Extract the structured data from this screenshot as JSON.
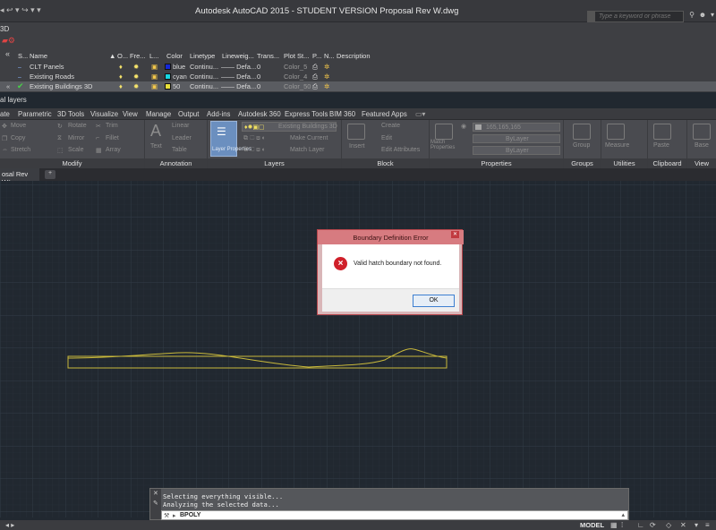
{
  "titlebar": {
    "title": "Autodesk AutoCAD 2015 - STUDENT VERSION    Proposal Rev W.dwg",
    "search_placeholder": "Type a keyword or phrase",
    "qat": "◂ ↩ ▾ ↪ ▾ ▾"
  },
  "layer_panel": {
    "top_label": "3D",
    "columns": {
      "status": "S...",
      "name": "Name",
      "on": "O...",
      "freeze": "Fre...",
      "lock": "L...",
      "color": "Color",
      "linetype": "Linetype",
      "lineweight": "Lineweig...",
      "transparency": "Trans...",
      "plotstyle": "Plot St...",
      "plot": "P...",
      "newvp": "N...",
      "description": "Description"
    },
    "rows": [
      {
        "name": "CLT Panels",
        "color": "blue",
        "color_hex": "#1428d8",
        "linetype": "Continu...",
        "lineweight": "Defa...",
        "transparency": "0",
        "plotstyle": "Color_5"
      },
      {
        "name": "Existing Roads",
        "color": "cyan",
        "color_hex": "#16d6e0",
        "linetype": "Continu...",
        "lineweight": "Defa...",
        "transparency": "0",
        "plotstyle": "Color_4"
      },
      {
        "name": "Existing Buildings 3D",
        "color": "50",
        "color_hex": "#e8e03a",
        "linetype": "Continu...",
        "lineweight": "Defa...",
        "transparency": "0",
        "plotstyle": "Color_50"
      }
    ],
    "footer": "al layers"
  },
  "ribbon_tabs": [
    "ate",
    "Parametric",
    "3D Tools",
    "Visualize",
    "View",
    "Manage",
    "Output",
    "Add-ins",
    "Autodesk 360",
    "Express Tools",
    "BIM 360",
    "Featured Apps"
  ],
  "ribbon": {
    "modify": {
      "label": "Modify",
      "items": [
        "Move",
        "Rotate",
        "Trim",
        "Copy",
        "Mirror",
        "Fillet",
        "Stretch",
        "Scale",
        "Array"
      ]
    },
    "annotation": {
      "label": "Annotation",
      "text": "Text",
      "items": [
        "Linear",
        "Leader",
        "Table"
      ]
    },
    "layers": {
      "label": "Layers",
      "current_layer": "Existing Buildings 3D",
      "properties": "Layer Properties",
      "items": [
        "Make Current",
        "Match Layer"
      ]
    },
    "block": {
      "label": "Block",
      "insert": "Insert",
      "items": [
        "Create",
        "Edit",
        "Edit Attributes"
      ]
    },
    "properties": {
      "label": "Properties",
      "match": "Match Properties",
      "color": "165,165,165",
      "bylayer1": "ByLayer",
      "bylayer2": "ByLayer"
    },
    "groups": {
      "label": "Groups",
      "group": "Group"
    },
    "utilities": {
      "label": "Utilities",
      "measure": "Measure"
    },
    "clipboard": {
      "label": "Clipboard",
      "paste": "Paste"
    },
    "view": {
      "label": "View",
      "base": "Base"
    }
  },
  "doc_tab": {
    "label": "osal Rev W*"
  },
  "dialog": {
    "title": "Boundary Definition Error",
    "message": "Valid hatch boundary not found.",
    "ok_label": "OK"
  },
  "command": {
    "history": [
      "Selecting everything visible...",
      "Analyzing the selected data..."
    ],
    "input": "BPOLY"
  },
  "statusbar": {
    "model": "MODEL"
  }
}
